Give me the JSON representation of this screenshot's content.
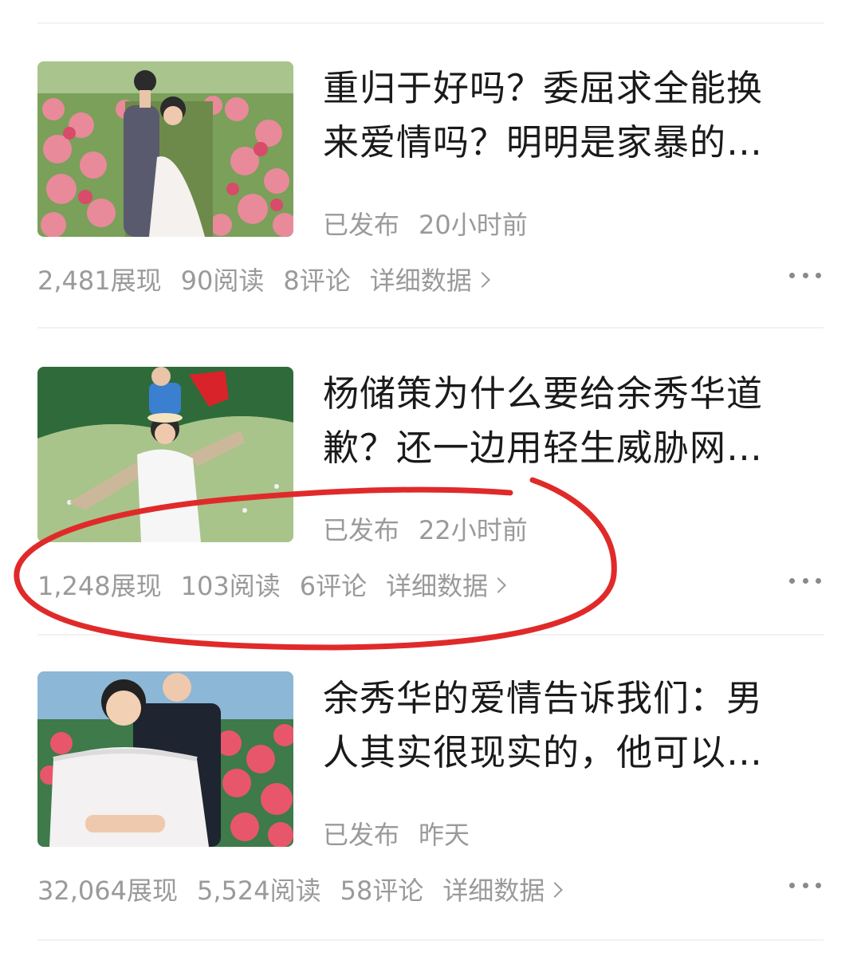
{
  "articles": [
    {
      "title_line1": "重归于好吗？委屈求全能换",
      "title_line2": "来爱情吗？明明是家暴的…",
      "status": "已发布",
      "time": "20小时前",
      "impressions": "2,481展现",
      "reads": "90阅读",
      "comments": "8评论",
      "detail": "详细数据"
    },
    {
      "title_line1": "杨储策为什么要给余秀华道",
      "title_line2": "歉？还一边用轻生威胁网…",
      "status": "已发布",
      "time": "22小时前",
      "impressions": "1,248展现",
      "reads": "103阅读",
      "comments": "6评论",
      "detail": "详细数据"
    },
    {
      "title_line1": "余秀华的爱情告诉我们：男",
      "title_line2": "人其实很现实的，他可以…",
      "status": "已发布",
      "time": "昨天",
      "impressions": "32,064展现",
      "reads": "5,524阅读",
      "comments": "58评论",
      "detail": "详细数据"
    }
  ],
  "icons": {
    "more": "more-dots-icon",
    "chevron": "chevron-right-icon"
  },
  "colors": {
    "annotation": "#e02a2a"
  }
}
